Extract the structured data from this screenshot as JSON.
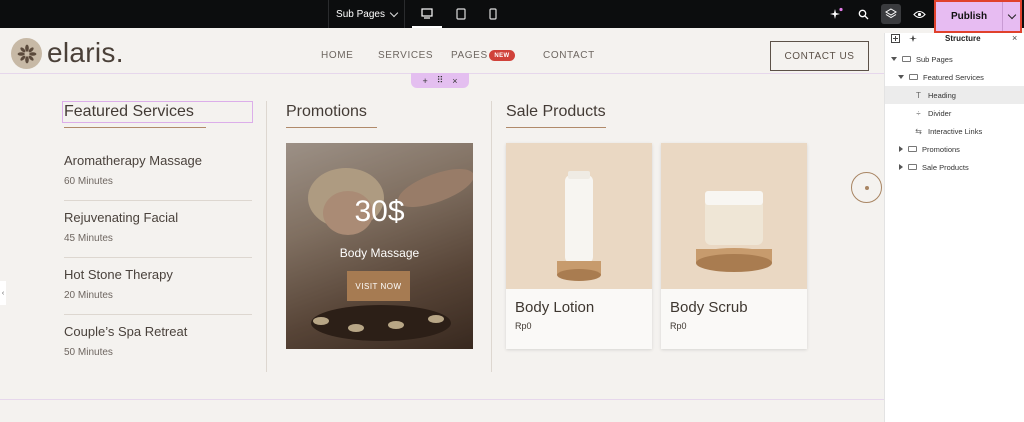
{
  "topbar": {
    "page_selector": "Sub Pages",
    "publish_label": "Publish"
  },
  "site": {
    "logo_text": "elaris.",
    "nav": [
      "HOME",
      "SERVICES",
      "PAGES",
      "CONTACT"
    ],
    "nav_badge": "NEW",
    "contact_button": "CONTACT US",
    "section_handle": {
      "add": "+",
      "move": "⠿",
      "close": "×"
    }
  },
  "featured": {
    "title": "Featured Services",
    "items": [
      {
        "name": "Aromatherapy Massage",
        "duration": "60 Minutes"
      },
      {
        "name": "Rejuvenating Facial",
        "duration": "45 Minutes"
      },
      {
        "name": "Hot Stone Therapy",
        "duration": "20 Minutes"
      },
      {
        "name": "Couple’s Spa Retreat",
        "duration": "50 Minutes"
      }
    ]
  },
  "promotions": {
    "title": "Promotions",
    "price": "30$",
    "subtitle": "Body Massage",
    "button": "VISIT NOW"
  },
  "sale": {
    "title": "Sale Products",
    "products": [
      {
        "name": "Body Lotion",
        "price": "Rp0"
      },
      {
        "name": "Body Scrub",
        "price": "Rp0"
      }
    ]
  },
  "structure_panel": {
    "title": "Structure",
    "close": "×",
    "tree": [
      {
        "label": "Sub Pages",
        "icon": "folder-icon"
      },
      {
        "label": "Featured Services",
        "icon": "folder-icon"
      },
      {
        "label": "Heading",
        "icon": "heading-icon"
      },
      {
        "label": "Divider",
        "icon": "divider-icon"
      },
      {
        "label": "Interactive Links",
        "icon": "links-icon"
      },
      {
        "label": "Promotions",
        "icon": "folder-icon"
      },
      {
        "label": "Sale Products",
        "icon": "folder-icon"
      }
    ]
  },
  "colors": {
    "publish": "#e7bcf2",
    "highlight_border": "#e0412c",
    "accent_brown": "#a67b52",
    "badge_red": "#d0423a",
    "page_bg": "#f4f2ef"
  }
}
